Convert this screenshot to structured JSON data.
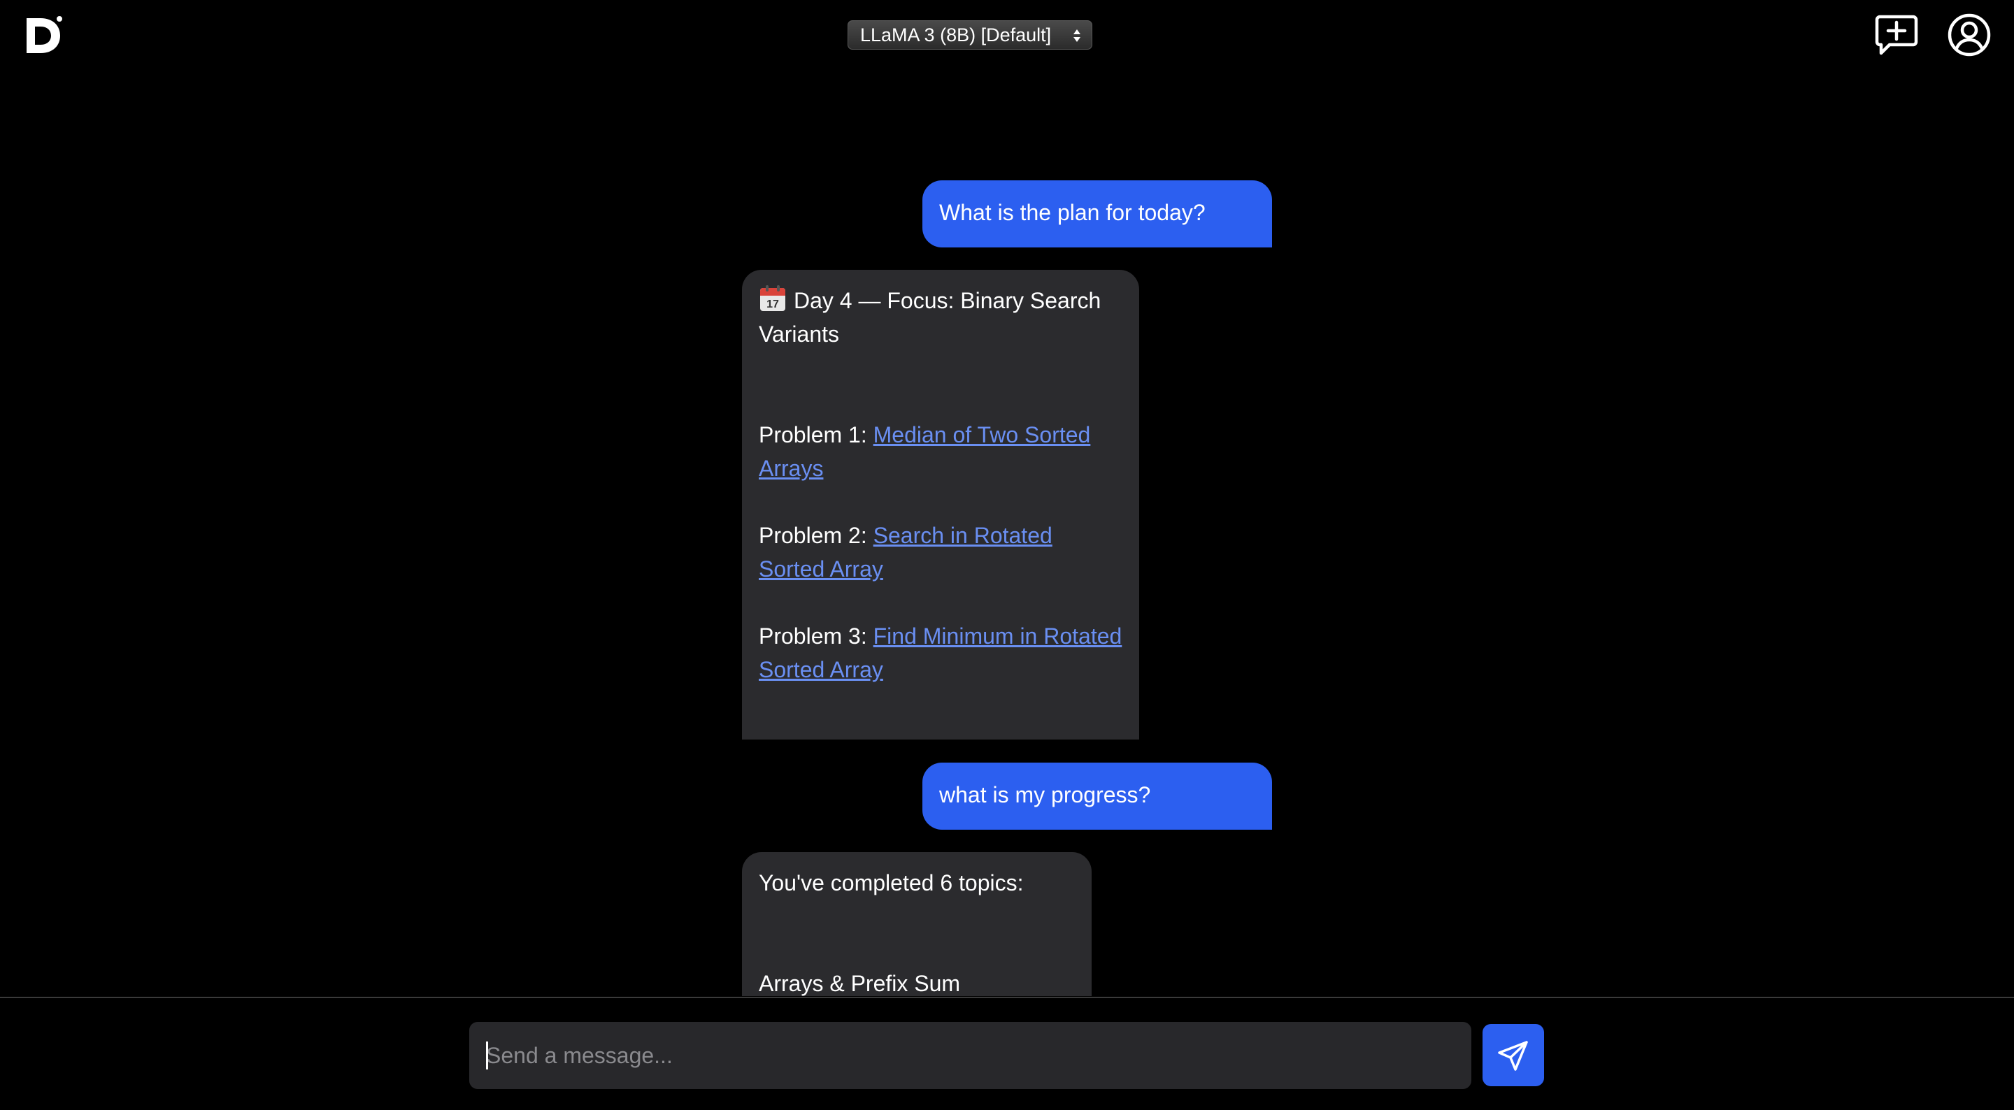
{
  "header": {
    "logo_icon": "d-logo-icon",
    "model_select": {
      "selected": "LLaMA 3 (8B) [Default]"
    },
    "new_chat_icon": "message-plus-icon",
    "profile_icon": "user-circle-icon"
  },
  "messages": [
    {
      "role": "user",
      "text": "What is the plan for today?"
    },
    {
      "role": "assistant",
      "title_icon": "calendar-icon",
      "title": "Day 4 — Focus: Binary Search Variants",
      "problems": [
        {
          "prefix": "Problem 1: ",
          "link": "Median of Two Sorted Arrays"
        },
        {
          "prefix": "Problem 2: ",
          "link": "Search in Rotated Sorted Array"
        },
        {
          "prefix": "Problem 3: ",
          "link": "Find Minimum in Rotated Sorted Array"
        }
      ]
    },
    {
      "role": "user",
      "text": "what is my progress?"
    },
    {
      "role": "assistant",
      "intro": "You've completed 6 topics:",
      "items": [
        "Arrays & Prefix Sum"
      ]
    }
  ],
  "composer": {
    "placeholder": "Send a message...",
    "value": "",
    "send_icon": "send-icon"
  },
  "colors": {
    "background": "#000000",
    "user_bubble": "#2c5ff0",
    "assistant_bubble": "#2b2b2e",
    "link": "#6a8ff2",
    "input_bg": "#28282b"
  }
}
